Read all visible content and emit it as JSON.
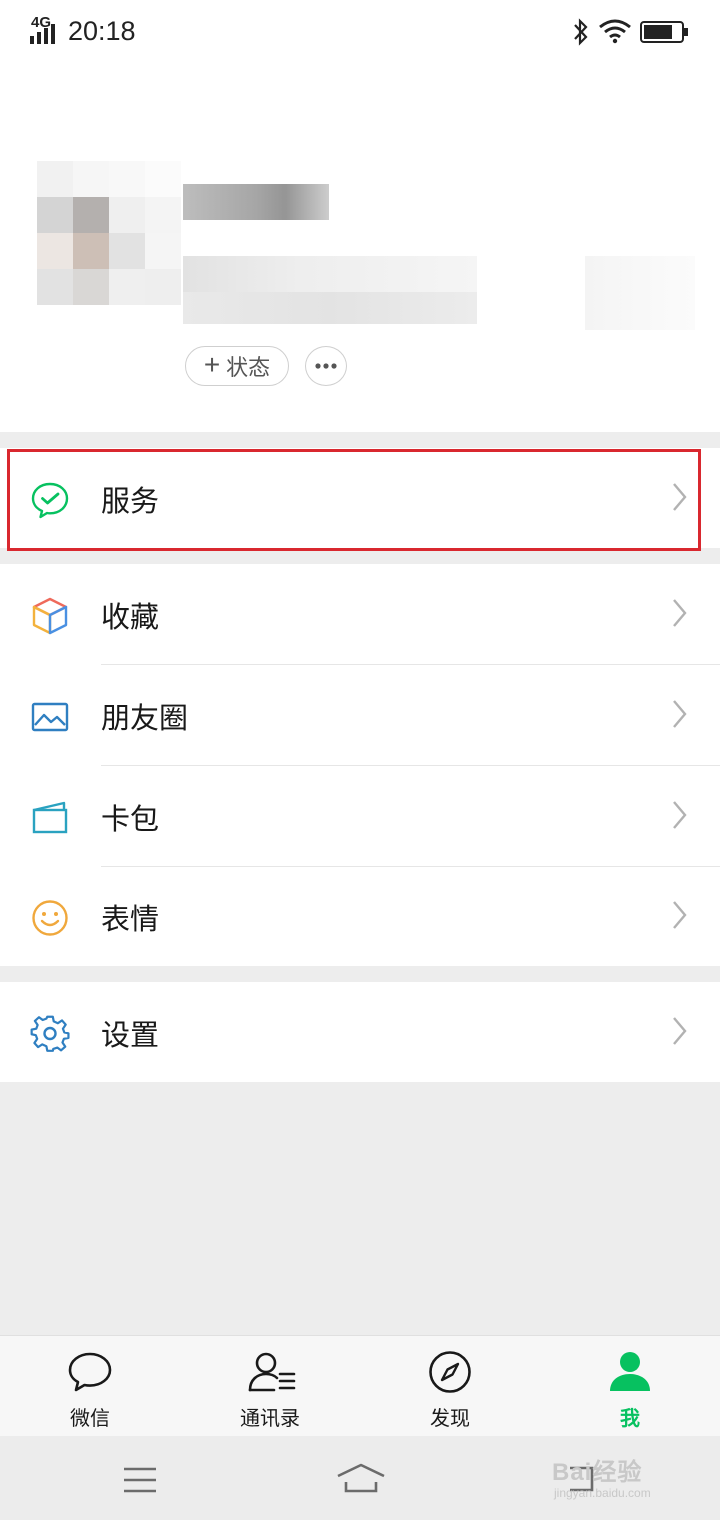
{
  "status_bar": {
    "network": "4G",
    "time": "20:18"
  },
  "profile": {
    "status_button_label": "状态",
    "status_button_plus": "+"
  },
  "menu": {
    "services": "服务",
    "favorites": "收藏",
    "moments": "朋友圈",
    "card_wallet": "卡包",
    "stickers": "表情",
    "settings": "设置"
  },
  "icons": {
    "services": "chat-check-icon",
    "favorites": "cube-icon",
    "moments": "image-icon",
    "card_wallet": "card-icon",
    "stickers": "smiley-icon",
    "settings": "gear-icon"
  },
  "tabs": [
    {
      "label": "微信",
      "active": false
    },
    {
      "label": "通讯录",
      "active": false
    },
    {
      "label": "发现",
      "active": false
    },
    {
      "label": "我",
      "active": true
    }
  ],
  "watermark": {
    "brand": "Bai经验",
    "url": "jingyan.baidu.com"
  },
  "colors": {
    "accent_green": "#07c160",
    "highlight_red": "#d9282f",
    "background": "#ededed"
  }
}
